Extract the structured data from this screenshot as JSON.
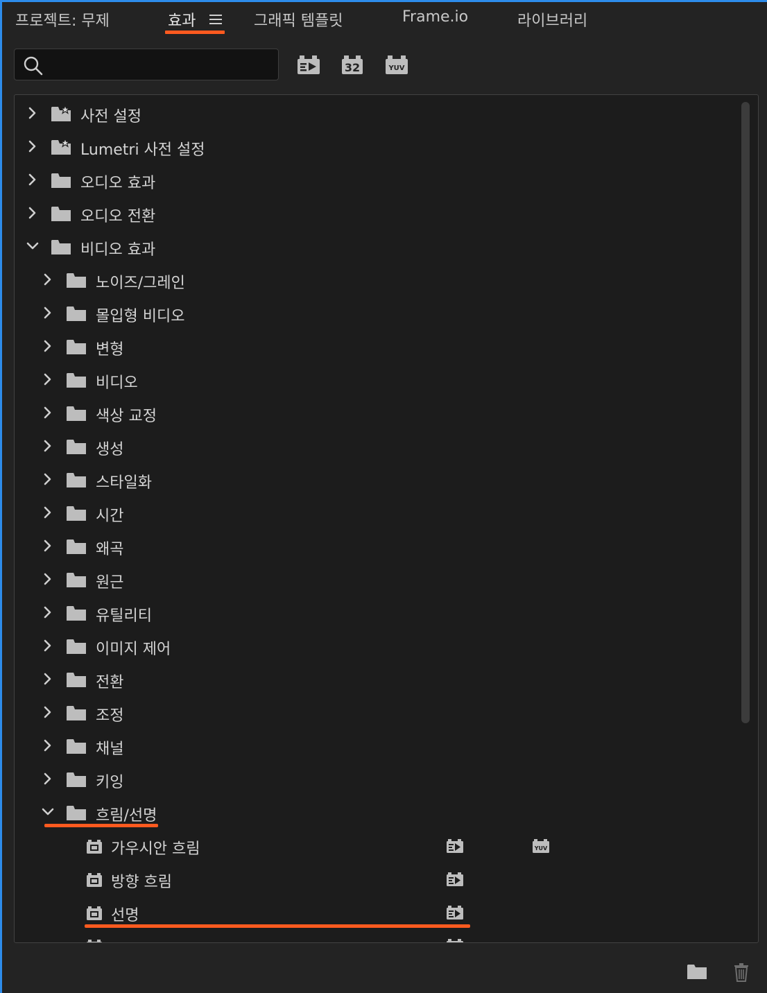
{
  "tabs": [
    {
      "label": "프로젝트: 무제",
      "active": false
    },
    {
      "label": "효과",
      "active": true
    },
    {
      "label": "그래픽 템플릿",
      "active": false
    },
    {
      "label": "Frame.io",
      "active": false
    },
    {
      "label": "라이브러리",
      "active": false
    }
  ],
  "panel_menu_icon": "hamburger-menu-icon",
  "search": {
    "value": "",
    "placeholder": ""
  },
  "filters": [
    {
      "icon": "accelerated-effects-icon",
      "label": ""
    },
    {
      "icon": "32-bit-color-icon",
      "label": "32"
    },
    {
      "icon": "yuv-effects-icon",
      "label": "YUV"
    }
  ],
  "tree": [
    {
      "label": "사전 설정",
      "type": "preset-folder",
      "expanded": false,
      "depth": 0
    },
    {
      "label": "Lumetri 사전 설정",
      "type": "preset-folder",
      "expanded": false,
      "depth": 0
    },
    {
      "label": "오디오 효과",
      "type": "folder",
      "expanded": false,
      "depth": 0
    },
    {
      "label": "오디오 전환",
      "type": "folder",
      "expanded": false,
      "depth": 0
    },
    {
      "label": "비디오 효과",
      "type": "folder",
      "expanded": true,
      "depth": 0
    },
    {
      "label": "노이즈/그레인",
      "type": "folder",
      "expanded": false,
      "depth": 1
    },
    {
      "label": "몰입형 비디오",
      "type": "folder",
      "expanded": false,
      "depth": 1
    },
    {
      "label": "변형",
      "type": "folder",
      "expanded": false,
      "depth": 1
    },
    {
      "label": "비디오",
      "type": "folder",
      "expanded": false,
      "depth": 1
    },
    {
      "label": "색상 교정",
      "type": "folder",
      "expanded": false,
      "depth": 1
    },
    {
      "label": "생성",
      "type": "folder",
      "expanded": false,
      "depth": 1
    },
    {
      "label": "스타일화",
      "type": "folder",
      "expanded": false,
      "depth": 1
    },
    {
      "label": "시간",
      "type": "folder",
      "expanded": false,
      "depth": 1
    },
    {
      "label": "왜곡",
      "type": "folder",
      "expanded": false,
      "depth": 1
    },
    {
      "label": "원근",
      "type": "folder",
      "expanded": false,
      "depth": 1
    },
    {
      "label": "유틸리티",
      "type": "folder",
      "expanded": false,
      "depth": 1
    },
    {
      "label": "이미지 제어",
      "type": "folder",
      "expanded": false,
      "depth": 1
    },
    {
      "label": "전환",
      "type": "folder",
      "expanded": false,
      "depth": 1
    },
    {
      "label": "조정",
      "type": "folder",
      "expanded": false,
      "depth": 1
    },
    {
      "label": "채널",
      "type": "folder",
      "expanded": false,
      "depth": 1
    },
    {
      "label": "키잉",
      "type": "folder",
      "expanded": false,
      "depth": 1
    },
    {
      "label": "흐림/선명",
      "type": "folder",
      "expanded": true,
      "depth": 1
    },
    {
      "label": "가우시안 흐림",
      "type": "effect",
      "depth": 2,
      "accelerated": true,
      "yuv": true
    },
    {
      "label": "방향 흐림",
      "type": "effect",
      "depth": 2,
      "accelerated": true,
      "yuv": false
    },
    {
      "label": "선명",
      "type": "effect",
      "depth": 2,
      "accelerated": true,
      "yuv": false
    },
    {
      "label": "",
      "type": "effect",
      "depth": 2,
      "accelerated": true,
      "yuv": false
    }
  ],
  "footer": {
    "new_folder_icon": "new-custom-bin-icon",
    "delete_icon": "trash-icon"
  },
  "colors": {
    "accent_underline": "#ff5a1f",
    "window_border": "#2d8ceb",
    "background": "#232323",
    "panel_background": "#1c1c1c"
  }
}
